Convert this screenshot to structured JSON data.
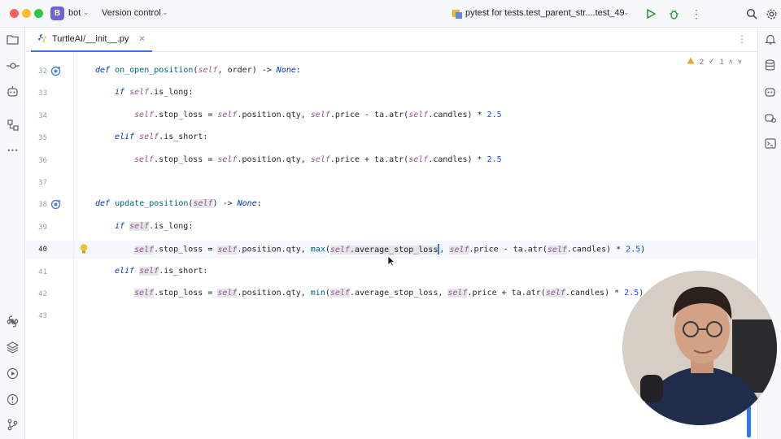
{
  "titlebar": {
    "project_badge": "B",
    "project_name": "bot",
    "vcs_label": "Version control",
    "run_config": "pytest for tests.test_parent_str....test_49",
    "icons": [
      "window-close-dot",
      "window-minimize-dot",
      "window-maximize-dot",
      "run-icon",
      "debug-icon",
      "more-icon",
      "search-icon",
      "settings-icon"
    ]
  },
  "tab": {
    "label": "TurtleAI/__init__.py"
  },
  "inspections": {
    "warnings": "2",
    "checks": "1"
  },
  "editor": {
    "current_line": "40",
    "lines": [
      {
        "num": "32",
        "tokens": [
          [
            "kw",
            "def "
          ],
          [
            "fn",
            "on_open_position"
          ],
          [
            "p",
            "("
          ],
          [
            "slf",
            "self"
          ],
          [
            "p",
            ", order) -> "
          ],
          [
            "kw",
            "None"
          ],
          [
            "p",
            ":"
          ]
        ],
        "indent": 0,
        "gutter": "override"
      },
      {
        "num": "33",
        "tokens": [
          [
            "kw",
            "if "
          ],
          [
            "slf",
            "self"
          ],
          [
            "p",
            ".is_long:"
          ]
        ],
        "indent": 1
      },
      {
        "num": "34",
        "tokens": [
          [
            "slf",
            "self"
          ],
          [
            "p",
            ".stop_loss = "
          ],
          [
            "slf",
            "self"
          ],
          [
            "p",
            ".position.qty, "
          ],
          [
            "slf",
            "self"
          ],
          [
            "p",
            ".price - ta.atr("
          ],
          [
            "slf",
            "self"
          ],
          [
            "p",
            ".candles) * "
          ],
          [
            "nm",
            "2.5"
          ]
        ],
        "indent": 2
      },
      {
        "num": "35",
        "tokens": [
          [
            "kw",
            "elif "
          ],
          [
            "slf",
            "self"
          ],
          [
            "p",
            ".is_short:"
          ]
        ],
        "indent": 1
      },
      {
        "num": "36",
        "tokens": [
          [
            "slf",
            "self"
          ],
          [
            "p",
            ".stop_loss = "
          ],
          [
            "slf",
            "self"
          ],
          [
            "p",
            ".position.qty, "
          ],
          [
            "slf",
            "self"
          ],
          [
            "p",
            ".price + ta.atr("
          ],
          [
            "slf",
            "self"
          ],
          [
            "p",
            ".candles) * "
          ],
          [
            "nm",
            "2.5"
          ]
        ],
        "indent": 2
      },
      {
        "num": "37",
        "tokens": [],
        "indent": 0
      },
      {
        "num": "38",
        "tokens": [
          [
            "kw",
            "def "
          ],
          [
            "fn",
            "update_position"
          ],
          [
            "p",
            "("
          ],
          [
            "slfh",
            "self"
          ],
          [
            "p",
            ") -> "
          ],
          [
            "kw",
            "None"
          ],
          [
            "p",
            ":"
          ]
        ],
        "indent": 0,
        "gutter": "override"
      },
      {
        "num": "39",
        "tokens": [
          [
            "kw",
            "if "
          ],
          [
            "slfh",
            "self"
          ],
          [
            "p",
            ".is_long:"
          ]
        ],
        "indent": 1
      },
      {
        "num": "40",
        "tokens": [
          [
            "slfh",
            "self"
          ],
          [
            "p",
            ".stop_loss = "
          ],
          [
            "slfh",
            "self"
          ],
          [
            "p",
            ".position.qty, "
          ],
          [
            "fn",
            "max"
          ],
          [
            "p",
            "("
          ],
          [
            "hlstart",
            "self.average_stop_loss"
          ],
          [
            "caret",
            ","
          ],
          [
            "p",
            " "
          ],
          [
            "slfh",
            "self"
          ],
          [
            "p",
            ".price - ta.atr("
          ],
          [
            "slfh",
            "self"
          ],
          [
            "p",
            ".candles) * "
          ],
          [
            "nm",
            "2.5"
          ],
          [
            "p",
            ")"
          ]
        ],
        "indent": 2,
        "gutter": "bulb"
      },
      {
        "num": "41",
        "tokens": [
          [
            "kw",
            "elif "
          ],
          [
            "slfh",
            "self"
          ],
          [
            "p",
            ".is_short:"
          ]
        ],
        "indent": 1
      },
      {
        "num": "42",
        "tokens": [
          [
            "slfh",
            "self"
          ],
          [
            "p",
            ".stop_loss = "
          ],
          [
            "slfh",
            "self"
          ],
          [
            "p",
            ".position.qty, "
          ],
          [
            "fn",
            "min"
          ],
          [
            "p",
            "("
          ],
          [
            "slfh",
            "self"
          ],
          [
            "p",
            ".average_stop_loss, "
          ],
          [
            "slfh",
            "self"
          ],
          [
            "p",
            ".price + ta.atr("
          ],
          [
            "slfh",
            "self"
          ],
          [
            "p",
            ".candles) * "
          ],
          [
            "nm",
            "2.5"
          ],
          [
            "p",
            ")"
          ]
        ],
        "indent": 2
      },
      {
        "num": "43",
        "tokens": [],
        "indent": 0
      }
    ]
  },
  "left_tools": [
    "project-folder-icon",
    "commit-icon",
    "ai-assistant-icon",
    "structure-icon",
    "more-tools-icon",
    "python-packages-icon",
    "layers-icon",
    "run-tool-icon",
    "problems-icon",
    "git-icon"
  ],
  "right_tools": [
    "notifications-icon",
    "database-icon",
    "ai-chat-icon",
    "copilot-icon",
    "terminal-icon"
  ],
  "colors": {
    "accent": "#3574f0",
    "keyword": "#0033b3",
    "function": "#00627a",
    "self": "#94558d",
    "number": "#1750eb"
  }
}
